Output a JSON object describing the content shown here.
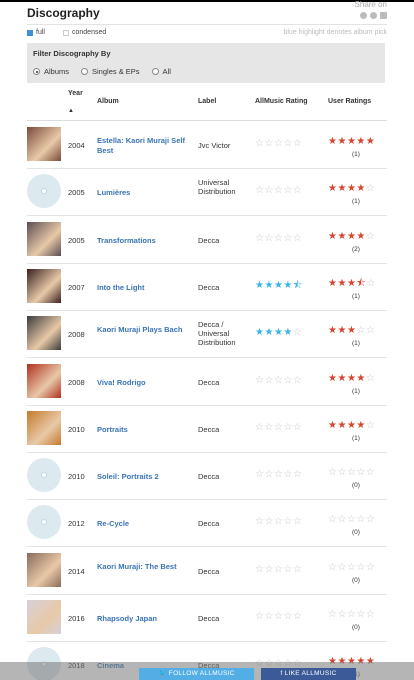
{
  "header": {
    "title": "Discography",
    "share_label": "Share on"
  },
  "view": {
    "full": "full",
    "condensed": "condensed",
    "hint": "blue highlight denotes album pick"
  },
  "filter": {
    "title": "Filter Discography By",
    "options": [
      "Albums",
      "Singles & EPs",
      "All"
    ],
    "selected": "Albums"
  },
  "columns": {
    "year": "Year",
    "sort_arrow": "▲",
    "album": "Album",
    "label": "Label",
    "allmusic": "AllMusic Rating",
    "user": "User Ratings"
  },
  "rows": [
    {
      "year": "2004",
      "album": "Estella: Kaori Muraji Self Best",
      "label": "Jvc Victor",
      "allmusic_rating": 0,
      "user_rating": 5,
      "user_count": "(1)",
      "cover": "photo"
    },
    {
      "year": "2005",
      "album": "Lumières",
      "label": "Universal Distribution",
      "allmusic_rating": 0,
      "user_rating": 4,
      "user_count": "(1)",
      "cover": "disc"
    },
    {
      "year": "2005",
      "album": "Transformations",
      "label": "Decca",
      "allmusic_rating": 0,
      "user_rating": 4,
      "user_count": "(2)",
      "cover": "photo"
    },
    {
      "year": "2007",
      "album": "Into the Light",
      "label": "Decca",
      "allmusic_rating": 4.5,
      "user_rating": 3.5,
      "user_count": "(1)",
      "cover": "photo"
    },
    {
      "year": "2008",
      "album": "Kaori Muraji Plays Bach",
      "label": "Decca / Universal Distribution",
      "allmusic_rating": 4,
      "user_rating": 3,
      "user_count": "(1)",
      "cover": "photo"
    },
    {
      "year": "2008",
      "album": "Viva! Rodrigo",
      "label": "Decca",
      "allmusic_rating": 0,
      "user_rating": 4,
      "user_count": "(1)",
      "cover": "photo"
    },
    {
      "year": "2010",
      "album": "Portraits",
      "label": "Decca",
      "allmusic_rating": 0,
      "user_rating": 4,
      "user_count": "(1)",
      "cover": "photo"
    },
    {
      "year": "2010",
      "album": "Soleil: Portraits 2",
      "label": "Decca",
      "allmusic_rating": 0,
      "user_rating": 0,
      "user_count": "(0)",
      "cover": "disc"
    },
    {
      "year": "2012",
      "album": "Re-Cycle",
      "label": "Decca",
      "allmusic_rating": 0,
      "user_rating": 0,
      "user_count": "(0)",
      "cover": "disc"
    },
    {
      "year": "2014",
      "album": "Kaori Muraji: The Best",
      "label": "Decca",
      "allmusic_rating": 0,
      "user_rating": 0,
      "user_count": "(0)",
      "cover": "photo"
    },
    {
      "year": "2016",
      "album": "Rhapsody Japan",
      "label": "Decca",
      "allmusic_rating": 0,
      "user_rating": 0,
      "user_count": "(0)",
      "cover": "photo"
    },
    {
      "year": "2018",
      "album": "Cinema",
      "label": "Decca",
      "allmusic_rating": 0,
      "user_rating": 5,
      "user_count": "(1)",
      "cover": "disc"
    }
  ],
  "footer": {
    "follow": "FOLLOW ALLMUSIC",
    "like": "LIKE ALLMUSIC"
  },
  "colors": {
    "link": "#3a74b5",
    "user_star": "#d9442f",
    "pick_star": "#3cb4e5",
    "empty_star": "#c8c8c8"
  }
}
